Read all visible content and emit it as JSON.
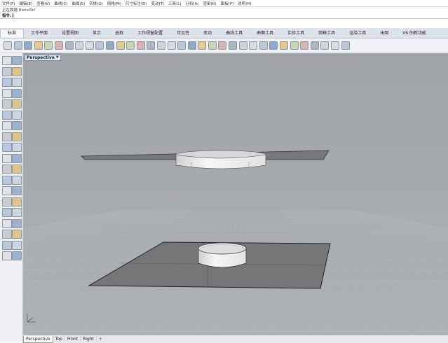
{
  "menubar": [
    "文件(F)",
    "编辑(E)",
    "查看(V)",
    "曲线(C)",
    "曲面(S)",
    "实体(O)",
    "网格(M)",
    "尺寸标注(D)",
    "变动(T)",
    "工具(L)",
    "分析(A)",
    "渲染(R)",
    "面板(P)",
    "说明(H)"
  ],
  "command_history": "正在数据 BlendSrf",
  "command_prompt": "指令:",
  "tabs": [
    {
      "label": "标准",
      "active": true
    },
    {
      "label": "工作平面",
      "active": false
    },
    {
      "label": "设置视图",
      "active": false
    },
    {
      "label": "显示",
      "active": false
    },
    {
      "label": "选取",
      "active": false
    },
    {
      "label": "工作视窗配置",
      "active": false
    },
    {
      "label": "可见性",
      "active": false
    },
    {
      "label": "变动",
      "active": false
    },
    {
      "label": "曲线工具",
      "active": false
    },
    {
      "label": "曲面工具",
      "active": false
    },
    {
      "label": "实体工具",
      "active": false
    },
    {
      "label": "网格工具",
      "active": false
    },
    {
      "label": "渲染工具",
      "active": false
    },
    {
      "label": "出图",
      "active": false
    },
    {
      "label": "V6 的新功能",
      "active": false
    }
  ],
  "toolbar_icons": [
    "new-icon",
    "open-icon",
    "save-icon",
    "print-icon",
    "import-icon",
    "cut-icon",
    "copy-icon",
    "paste-icon",
    "undo-icon",
    "pan-icon",
    "move-view-icon",
    "zoom-icon",
    "zoom-window-icon",
    "zoom-extents-icon",
    "zoom-selected-icon",
    "rotate-view-icon",
    "viewport-layout-icon",
    "car-icon",
    "cplane-icon",
    "cplane-world-icon",
    "named-view-icon",
    "light-icon",
    "lock-icon",
    "layer-icon",
    "render-sphere-icon",
    "shaded-sphere-icon",
    "ghosted-sphere-icon",
    "xray-sphere-icon",
    "material-icon",
    "bulb-icon",
    "options-icon",
    "group-icon",
    "globe-icon",
    "help-icon"
  ],
  "viewport": {
    "label": "Perspective",
    "background": "#a3a6a9"
  },
  "view_tabs": [
    {
      "label": "Perspective",
      "active": true
    },
    {
      "label": "Top",
      "active": false
    },
    {
      "label": "Front",
      "active": false
    },
    {
      "label": "Right",
      "active": false
    },
    {
      "label": "+",
      "active": false
    }
  ],
  "colors": {
    "accent": "#2c6fbf",
    "surface": "#7e8082",
    "cylinder": "#ececec"
  }
}
